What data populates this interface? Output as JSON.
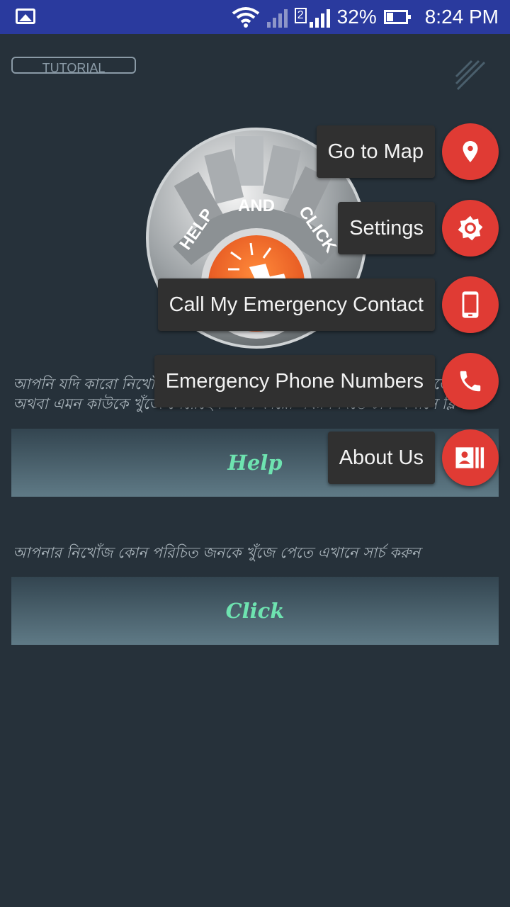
{
  "status_bar": {
    "battery_percent": "32%",
    "time": "8:24 PM",
    "sim_slot": "2",
    "icons": [
      "gallery-notification-icon",
      "wifi-icon",
      "signal-icon",
      "battery-icon"
    ]
  },
  "header": {
    "tutorial_label": "TUTORIAL",
    "menu_icon": "menu-icon"
  },
  "logo": {
    "word_help": "HELP",
    "word_and": "AND",
    "word_click": "CLICK"
  },
  "main": {
    "help_description": "আপনি যদি কারো নিখোঁজ কোন পরিচিত জনকে খুঁজে পান সেই তথ্য দিতে চান অথবা এমন কাউকে খুঁজে পেয়েছেন এমন কারো সন্ধান দিতে চান এখানে ক্লিক করুন",
    "help_button": "Help",
    "click_description": "আপনার নিখোঁজ কোন পরিচিত জনকে খুঁজে পেতে এখানে সার্চ  করুন",
    "click_button": "Click"
  },
  "fab_menu": [
    {
      "label": "Go to Map",
      "icon": "location-pin-icon"
    },
    {
      "label": "Settings",
      "icon": "settings-icon"
    },
    {
      "label": "Call My Emergency Contact",
      "icon": "smartphone-icon"
    },
    {
      "label": "Emergency Phone Numbers",
      "icon": "phone-icon"
    },
    {
      "label": "About Us",
      "icon": "contact-card-icon"
    }
  ],
  "colors": {
    "background": "#26313a",
    "status_bar": "#2a3a9e",
    "fab": "#e03b34",
    "button_text": "#6ee3b0",
    "label_bg": "#303030"
  }
}
